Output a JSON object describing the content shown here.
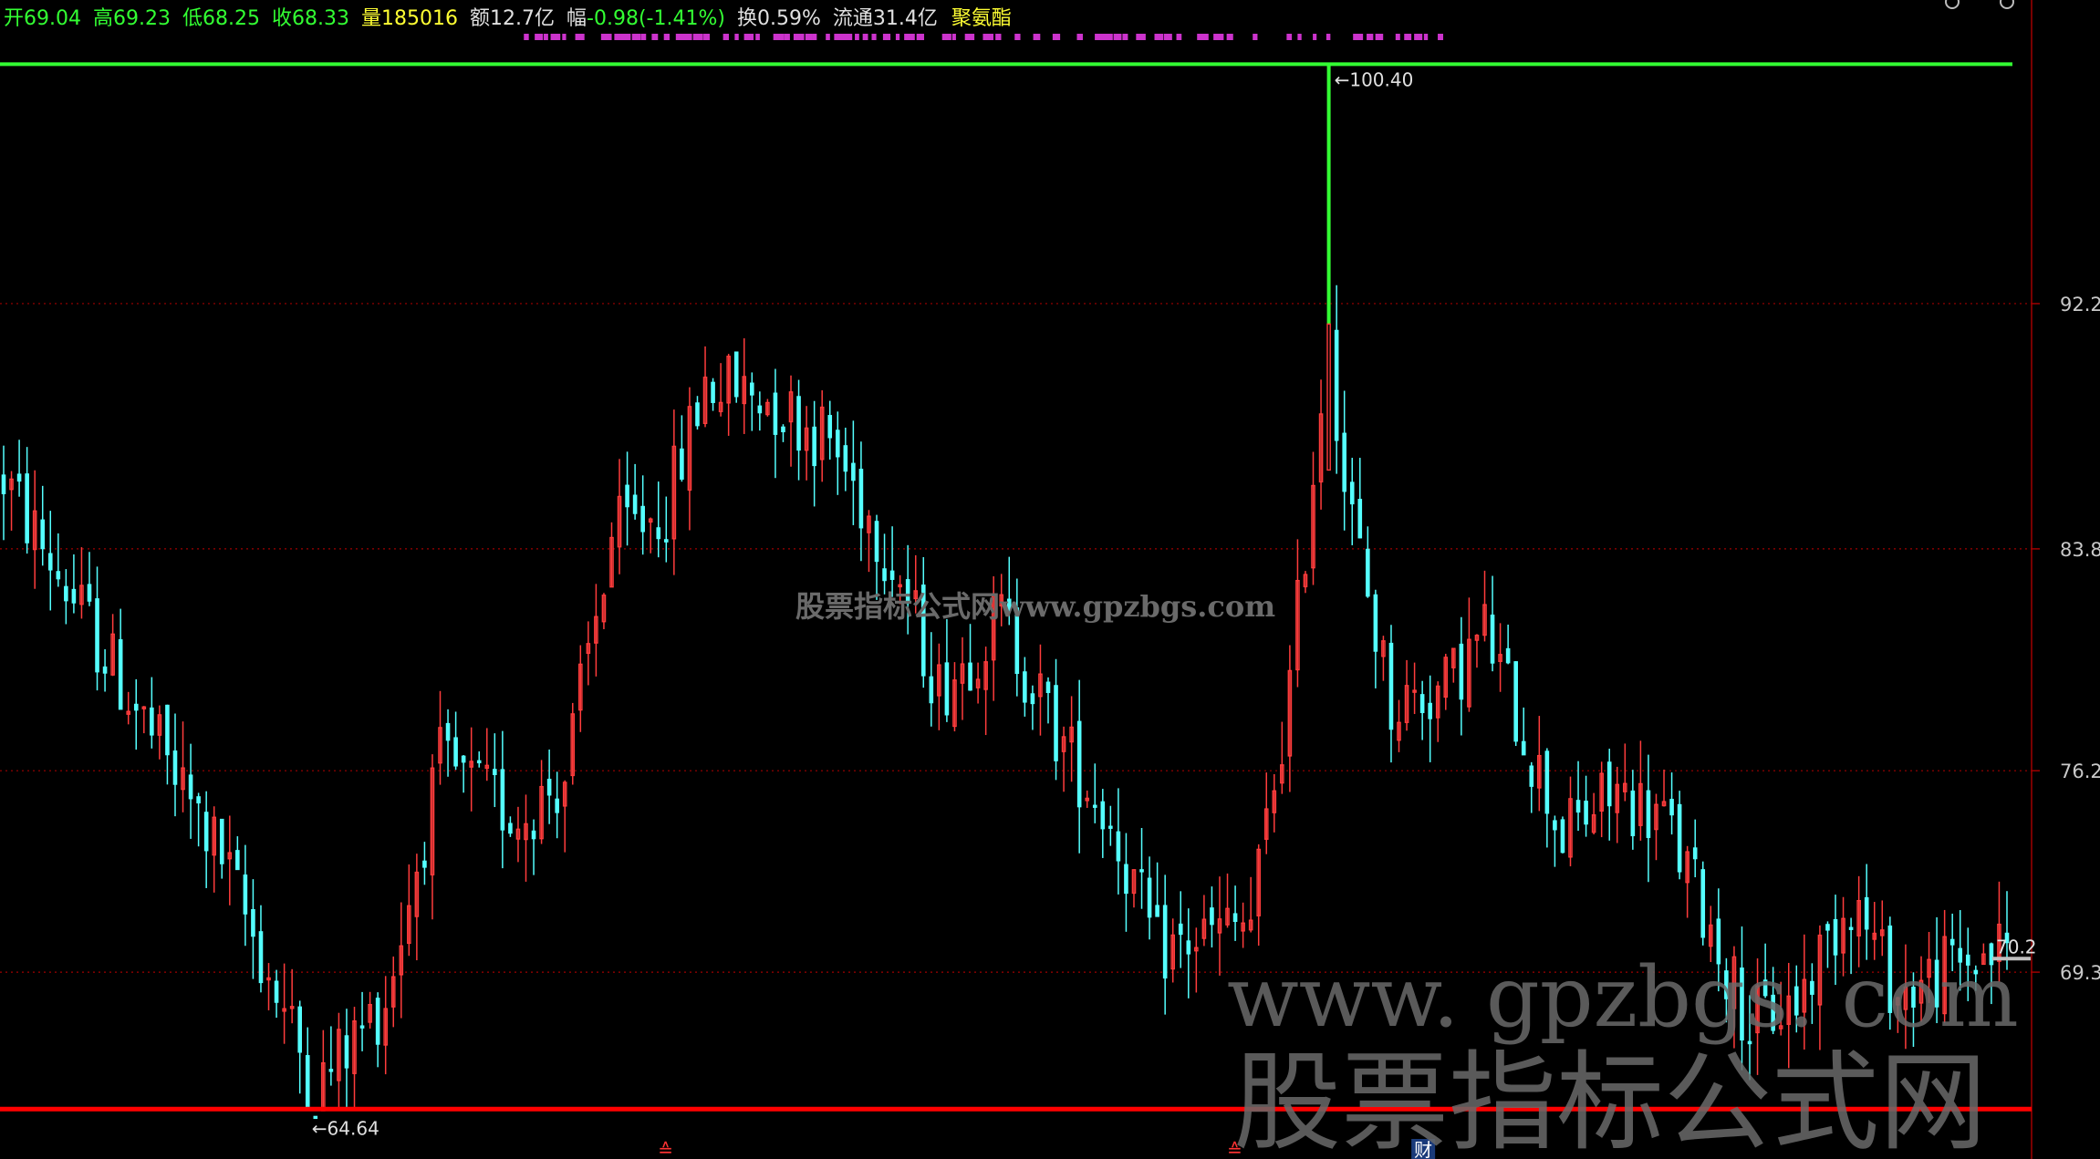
{
  "header": {
    "title_fragment": "",
    "open": {
      "label": "开",
      "value": "69.04"
    },
    "high": {
      "label": "高",
      "value": "69.23"
    },
    "low": {
      "label": "低",
      "value": "68.25"
    },
    "close": {
      "label": "收",
      "value": "68.33"
    },
    "volume": {
      "label": "量",
      "value": "185016"
    },
    "amount": {
      "label": "额",
      "value": "12.7亿"
    },
    "change": {
      "label": "幅",
      "value": "-0.98(-1.41%)"
    },
    "turnover": {
      "label": "换",
      "value": "0.59%"
    },
    "float_cap": {
      "label": "流通",
      "value": "31.4亿"
    },
    "sector": "聚氨酯"
  },
  "colors": {
    "background": "#000000",
    "up_candle": "#ff3c3c",
    "down_candle": "#54ffff",
    "gridline": "#a00000",
    "axis_text": "#c8c8c8",
    "high_line": "#33ff33",
    "low_line": "#ff0000",
    "header_green": "#33ff33",
    "header_yellow": "#ffff33",
    "header_white": "#e0e0e0",
    "event_marker": "#ff3333",
    "event_bar": "#cc33cc",
    "watermark": "#6a6a6a"
  },
  "chart_data": {
    "type": "candlestick",
    "y_ticks": [
      "92.2",
      "83.8",
      "76.2",
      "69.3"
    ],
    "y_tick_values": [
      92.2,
      83.8,
      76.2,
      69.3
    ],
    "ylim": [
      62.9,
      102.6
    ],
    "high_marker": {
      "label": "←100.40",
      "value": 100.4
    },
    "low_marker": {
      "label": "←64.64",
      "value": 64.64
    },
    "last_price_label": "70.2",
    "last_price_value": 70.2,
    "bar_count": 258,
    "high_index": 170,
    "low_index": 40,
    "price_path": [
      {
        "i": 0,
        "p": 86.2
      },
      {
        "i": 16,
        "p": 78.8
      },
      {
        "i": 28,
        "p": 73.2
      },
      {
        "i": 40,
        "p": 65.3
      },
      {
        "i": 49,
        "p": 68.4
      },
      {
        "i": 56,
        "p": 76.4
      },
      {
        "i": 66,
        "p": 74.6
      },
      {
        "i": 72,
        "p": 76.0
      },
      {
        "i": 78,
        "p": 84.2
      },
      {
        "i": 85,
        "p": 85.2
      },
      {
        "i": 90,
        "p": 89.5
      },
      {
        "i": 98,
        "p": 89.0
      },
      {
        "i": 106,
        "p": 87.5
      },
      {
        "i": 114,
        "p": 83.5
      },
      {
        "i": 120,
        "p": 79.0
      },
      {
        "i": 128,
        "p": 81.5
      },
      {
        "i": 135,
        "p": 77.5
      },
      {
        "i": 142,
        "p": 74.5
      },
      {
        "i": 148,
        "p": 70.0
      },
      {
        "i": 160,
        "p": 71.0
      },
      {
        "i": 165,
        "p": 79.0
      },
      {
        "i": 170,
        "p": 91.5
      },
      {
        "i": 172,
        "p": 86.0
      },
      {
        "i": 178,
        "p": 78.5
      },
      {
        "i": 185,
        "p": 79.0
      },
      {
        "i": 190,
        "p": 81.0
      },
      {
        "i": 195,
        "p": 77.5
      },
      {
        "i": 200,
        "p": 74.0
      },
      {
        "i": 207,
        "p": 75.5
      },
      {
        "i": 213,
        "p": 74.5
      },
      {
        "i": 218,
        "p": 71.5
      },
      {
        "i": 224,
        "p": 67.5
      },
      {
        "i": 230,
        "p": 68.3
      },
      {
        "i": 237,
        "p": 72.0
      },
      {
        "i": 243,
        "p": 68.5
      },
      {
        "i": 250,
        "p": 69.5
      },
      {
        "i": 257,
        "p": 70.2
      }
    ]
  },
  "event_markers": [
    {
      "glyph": "≙",
      "x_index": 85
    },
    {
      "glyph": "≙",
      "x_index": 158
    },
    {
      "glyph": "财",
      "x_index": 182
    }
  ],
  "watermark": {
    "small": "股票指标公式网www.gpzbgs.com",
    "url": "www. gpzbgs. com",
    "cn": "股票指标公式网"
  }
}
